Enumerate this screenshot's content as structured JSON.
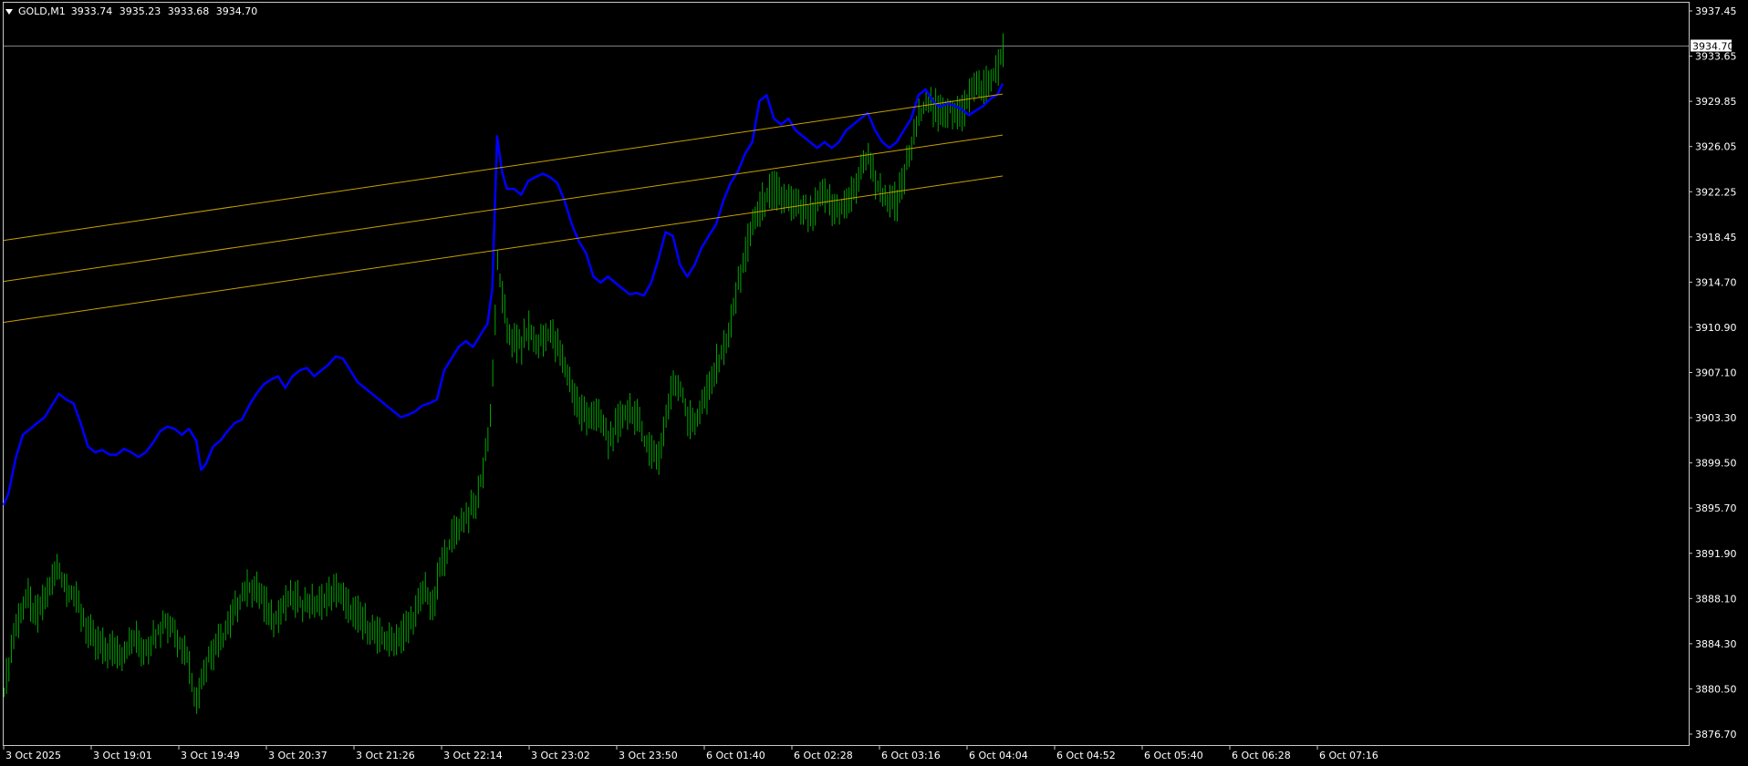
{
  "header": {
    "symbol": "GOLD,M1",
    "open": "3933.74",
    "high": "3935.23",
    "low": "3933.68",
    "close": "3934.70"
  },
  "colors": {
    "background": "#000000",
    "frame": "#c8c8c8",
    "text": "#ffffff",
    "price_line": "#808080",
    "current_price_bg": "#ffffff",
    "current_price_text": "#000000",
    "bar_color": "#00a800",
    "ma_color": "#0000ff",
    "channel_color": "#c8a000"
  },
  "chart_data": {
    "type": "line",
    "title": "",
    "xlabel": "",
    "ylabel": "",
    "grid": false,
    "legend": "none",
    "ylim": [
      3875.0,
      3938.4
    ],
    "y_ticks": [
      "3937.45",
      "3933.65",
      "3929.85",
      "3926.05",
      "3922.25",
      "3918.45",
      "3914.70",
      "3910.90",
      "3907.10",
      "3903.30",
      "3899.50",
      "3895.70",
      "3891.90",
      "3888.10",
      "3884.30",
      "3880.50",
      "3876.70"
    ],
    "x_ticks": [
      "3 Oct 2025",
      "3 Oct 19:01",
      "3 Oct 19:49",
      "3 Oct 20:37",
      "3 Oct 21:26",
      "3 Oct 22:14",
      "3 Oct 23:02",
      "3 Oct 23:50",
      "6 Oct 01:40",
      "6 Oct 02:28",
      "6 Oct 03:16",
      "6 Oct 04:04",
      "6 Oct 04:52",
      "6 Oct 05:40",
      "6 Oct 06:28",
      "6 Oct 07:16"
    ],
    "current_price": 3934.7,
    "current_price_label": "3934.70",
    "series": [
      {
        "kind": "bars",
        "color": "#00a800",
        "points": [
          [
            0,
            3879.5
          ],
          [
            2,
            3882.0
          ],
          [
            4,
            3884.5
          ],
          [
            7,
            3886.5
          ],
          [
            10,
            3887.5
          ],
          [
            13,
            3886.0
          ],
          [
            16,
            3887.0
          ],
          [
            19,
            3888.5
          ],
          [
            22,
            3890.0
          ],
          [
            25,
            3888.8
          ],
          [
            28,
            3888.0
          ],
          [
            31,
            3886.8
          ],
          [
            34,
            3885.2
          ],
          [
            37,
            3884.0
          ],
          [
            40,
            3883.5
          ],
          [
            43,
            3883.0
          ],
          [
            46,
            3883.4
          ],
          [
            49,
            3882.8
          ],
          [
            52,
            3883.5
          ],
          [
            55,
            3884.0
          ],
          [
            58,
            3883.2
          ],
          [
            61,
            3883.8
          ],
          [
            64,
            3884.8
          ],
          [
            67,
            3885.5
          ],
          [
            70,
            3885.0
          ],
          [
            73,
            3883.8
          ],
          [
            76,
            3882.8
          ],
          [
            78,
            3880.5
          ],
          [
            80,
            3878.5
          ],
          [
            82,
            3881.0
          ],
          [
            85,
            3882.5
          ],
          [
            88,
            3883.5
          ],
          [
            91,
            3884.0
          ],
          [
            94,
            3885.5
          ],
          [
            97,
            3887.0
          ],
          [
            100,
            3888.2
          ],
          [
            103,
            3888.5
          ],
          [
            106,
            3888.0
          ],
          [
            109,
            3886.8
          ],
          [
            112,
            3885.8
          ],
          [
            115,
            3886.5
          ],
          [
            118,
            3887.2
          ],
          [
            121,
            3887.5
          ],
          [
            124,
            3887.0
          ],
          [
            127,
            3887.2
          ],
          [
            130,
            3886.8
          ],
          [
            133,
            3887.5
          ],
          [
            136,
            3888.0
          ],
          [
            139,
            3888.2
          ],
          [
            142,
            3887.0
          ],
          [
            145,
            3886.2
          ],
          [
            148,
            3886.0
          ],
          [
            151,
            3885.2
          ],
          [
            154,
            3884.5
          ],
          [
            157,
            3884.0
          ],
          [
            160,
            3883.8
          ],
          [
            163,
            3884.2
          ],
          [
            166,
            3884.8
          ],
          [
            169,
            3885.5
          ],
          [
            172,
            3886.8
          ],
          [
            175,
            3888.5
          ],
          [
            178,
            3886.5
          ],
          [
            181,
            3890.0
          ],
          [
            184,
            3891.5
          ],
          [
            187,
            3893.2
          ],
          [
            190,
            3894.0
          ],
          [
            193,
            3894.8
          ],
          [
            196,
            3895.5
          ],
          [
            199,
            3898.5
          ],
          [
            202,
            3903.0
          ],
          [
            204,
            3911.0
          ],
          [
            205,
            3916.0
          ],
          [
            207,
            3913.0
          ],
          [
            209,
            3910.5
          ],
          [
            212,
            3909.5
          ],
          [
            215,
            3909.2
          ],
          [
            218,
            3910.5
          ],
          [
            221,
            3909.0
          ],
          [
            224,
            3909.8
          ],
          [
            227,
            3910.2
          ],
          [
            230,
            3909.0
          ],
          [
            233,
            3907.2
          ],
          [
            236,
            3905.5
          ],
          [
            239,
            3903.8
          ],
          [
            242,
            3903.2
          ],
          [
            245,
            3903.5
          ],
          [
            248,
            3902.5
          ],
          [
            251,
            3901.0
          ],
          [
            254,
            3902.0
          ],
          [
            257,
            3903.2
          ],
          [
            260,
            3903.8
          ],
          [
            263,
            3902.8
          ],
          [
            266,
            3901.0
          ],
          [
            269,
            3900.2
          ],
          [
            272,
            3899.8
          ],
          [
            275,
            3903.0
          ],
          [
            278,
            3906.0
          ],
          [
            281,
            3905.5
          ],
          [
            284,
            3903.0
          ],
          [
            287,
            3902.5
          ],
          [
            290,
            3904.0
          ],
          [
            293,
            3905.5
          ],
          [
            296,
            3907.5
          ],
          [
            299,
            3908.8
          ],
          [
            302,
            3911.0
          ],
          [
            305,
            3914.5
          ],
          [
            308,
            3917.0
          ],
          [
            311,
            3919.5
          ],
          [
            314,
            3921.0
          ],
          [
            317,
            3922.0
          ],
          [
            320,
            3922.5
          ],
          [
            323,
            3921.8
          ],
          [
            326,
            3921.5
          ],
          [
            329,
            3921.0
          ],
          [
            332,
            3920.5
          ],
          [
            335,
            3920.2
          ],
          [
            338,
            3921.2
          ],
          [
            341,
            3922.0
          ],
          [
            344,
            3921.0
          ],
          [
            347,
            3920.8
          ],
          [
            350,
            3921.2
          ],
          [
            353,
            3922.5
          ],
          [
            356,
            3923.8
          ],
          [
            359,
            3925.5
          ],
          [
            362,
            3923.0
          ],
          [
            365,
            3922.0
          ],
          [
            368,
            3921.2
          ],
          [
            371,
            3921.5
          ],
          [
            374,
            3923.8
          ],
          [
            377,
            3926.0
          ],
          [
            380,
            3928.5
          ],
          [
            383,
            3930.0
          ],
          [
            386,
            3929.5
          ],
          [
            389,
            3929.0
          ],
          [
            392,
            3929.5
          ],
          [
            395,
            3929.2
          ],
          [
            398,
            3929.0
          ],
          [
            401,
            3930.5
          ],
          [
            404,
            3931.5
          ],
          [
            407,
            3931.2
          ],
          [
            410,
            3931.8
          ],
          [
            413,
            3932.8
          ],
          [
            415,
            3934.5
          ]
        ]
      },
      {
        "kind": "line",
        "color": "#0000ff",
        "points": [
          [
            0,
            3895.5
          ],
          [
            2,
            3896.5
          ],
          [
            5,
            3899.5
          ],
          [
            8,
            3901.5
          ],
          [
            11,
            3902.0
          ],
          [
            14,
            3902.5
          ],
          [
            17,
            3903.0
          ],
          [
            20,
            3904.0
          ],
          [
            23,
            3905.0
          ],
          [
            26,
            3904.5
          ],
          [
            29,
            3904.2
          ],
          [
            32,
            3902.5
          ],
          [
            35,
            3900.5
          ],
          [
            38,
            3900.0
          ],
          [
            41,
            3900.2
          ],
          [
            44,
            3899.8
          ],
          [
            47,
            3899.8
          ],
          [
            50,
            3900.3
          ],
          [
            53,
            3900.0
          ],
          [
            56,
            3899.6
          ],
          [
            59,
            3900.0
          ],
          [
            62,
            3900.8
          ],
          [
            65,
            3901.8
          ],
          [
            68,
            3902.2
          ],
          [
            71,
            3902.0
          ],
          [
            74,
            3901.5
          ],
          [
            77,
            3902.0
          ],
          [
            80,
            3901.0
          ],
          [
            82,
            3898.5
          ],
          [
            84,
            3899.0
          ],
          [
            87,
            3900.5
          ],
          [
            90,
            3901.0
          ],
          [
            93,
            3901.8
          ],
          [
            96,
            3902.5
          ],
          [
            99,
            3902.8
          ],
          [
            102,
            3904.0
          ],
          [
            105,
            3905.0
          ],
          [
            108,
            3905.8
          ],
          [
            111,
            3906.2
          ],
          [
            114,
            3906.5
          ],
          [
            117,
            3905.5
          ],
          [
            120,
            3906.5
          ],
          [
            123,
            3907.0
          ],
          [
            126,
            3907.2
          ],
          [
            129,
            3906.5
          ],
          [
            132,
            3907.0
          ],
          [
            135,
            3907.5
          ],
          [
            138,
            3908.2
          ],
          [
            141,
            3908.0
          ],
          [
            144,
            3907.0
          ],
          [
            147,
            3906.0
          ],
          [
            150,
            3905.5
          ],
          [
            153,
            3905.0
          ],
          [
            156,
            3904.5
          ],
          [
            159,
            3904.0
          ],
          [
            162,
            3903.5
          ],
          [
            165,
            3903.0
          ],
          [
            168,
            3903.2
          ],
          [
            171,
            3903.5
          ],
          [
            174,
            3904.0
          ],
          [
            177,
            3904.2
          ],
          [
            180,
            3904.5
          ],
          [
            183,
            3907.0
          ],
          [
            186,
            3908.0
          ],
          [
            189,
            3909.0
          ],
          [
            192,
            3909.5
          ],
          [
            195,
            3909.0
          ],
          [
            198,
            3910.0
          ],
          [
            201,
            3911.0
          ],
          [
            203,
            3914.0
          ],
          [
            205,
            3927.0
          ],
          [
            207,
            3924.0
          ],
          [
            209,
            3922.5
          ],
          [
            212,
            3922.5
          ],
          [
            215,
            3922.0
          ],
          [
            218,
            3923.2
          ],
          [
            221,
            3923.5
          ],
          [
            224,
            3923.8
          ],
          [
            227,
            3923.5
          ],
          [
            230,
            3923.0
          ],
          [
            233,
            3921.5
          ],
          [
            236,
            3919.5
          ],
          [
            239,
            3918.0
          ],
          [
            242,
            3917.0
          ],
          [
            245,
            3915.0
          ],
          [
            248,
            3914.5
          ],
          [
            251,
            3915.0
          ],
          [
            254,
            3914.5
          ],
          [
            257,
            3914.0
          ],
          [
            260,
            3913.5
          ],
          [
            263,
            3913.6
          ],
          [
            266,
            3913.4
          ],
          [
            269,
            3914.5
          ],
          [
            272,
            3916.5
          ],
          [
            275,
            3918.8
          ],
          [
            278,
            3918.5
          ],
          [
            281,
            3916.0
          ],
          [
            284,
            3915.0
          ],
          [
            287,
            3916.0
          ],
          [
            290,
            3917.5
          ],
          [
            293,
            3918.5
          ],
          [
            296,
            3919.5
          ],
          [
            299,
            3921.5
          ],
          [
            302,
            3923.0
          ],
          [
            305,
            3924.0
          ],
          [
            308,
            3925.5
          ],
          [
            311,
            3926.5
          ],
          [
            314,
            3930.0
          ],
          [
            317,
            3930.5
          ],
          [
            320,
            3928.5
          ],
          [
            323,
            3928.0
          ],
          [
            326,
            3928.5
          ],
          [
            329,
            3927.5
          ],
          [
            332,
            3927.0
          ],
          [
            335,
            3926.5
          ],
          [
            338,
            3926.0
          ],
          [
            341,
            3926.5
          ],
          [
            344,
            3926.0
          ],
          [
            347,
            3926.5
          ],
          [
            350,
            3927.5
          ],
          [
            353,
            3928.0
          ],
          [
            356,
            3928.5
          ],
          [
            359,
            3929.0
          ],
          [
            362,
            3927.5
          ],
          [
            365,
            3926.5
          ],
          [
            368,
            3926.0
          ],
          [
            371,
            3926.5
          ],
          [
            374,
            3927.5
          ],
          [
            377,
            3928.5
          ],
          [
            380,
            3930.5
          ],
          [
            383,
            3931.0
          ],
          [
            386,
            3930.0
          ],
          [
            389,
            3929.5
          ],
          [
            392,
            3929.8
          ],
          [
            395,
            3929.6
          ],
          [
            398,
            3929.3
          ],
          [
            401,
            3928.8
          ],
          [
            404,
            3929.2
          ],
          [
            407,
            3929.6
          ],
          [
            410,
            3930.2
          ],
          [
            413,
            3930.6
          ],
          [
            415,
            3931.5
          ]
        ]
      },
      {
        "kind": "line",
        "color": "#c8a000",
        "points": [
          [
            0,
            3918.1
          ],
          [
            415,
            3930.6
          ]
        ]
      },
      {
        "kind": "line",
        "color": "#c8a000",
        "points": [
          [
            0,
            3914.6
          ],
          [
            415,
            3927.1
          ]
        ]
      },
      {
        "kind": "line",
        "color": "#c8a000",
        "points": [
          [
            0,
            3911.1
          ],
          [
            415,
            3923.6
          ]
        ]
      }
    ]
  }
}
